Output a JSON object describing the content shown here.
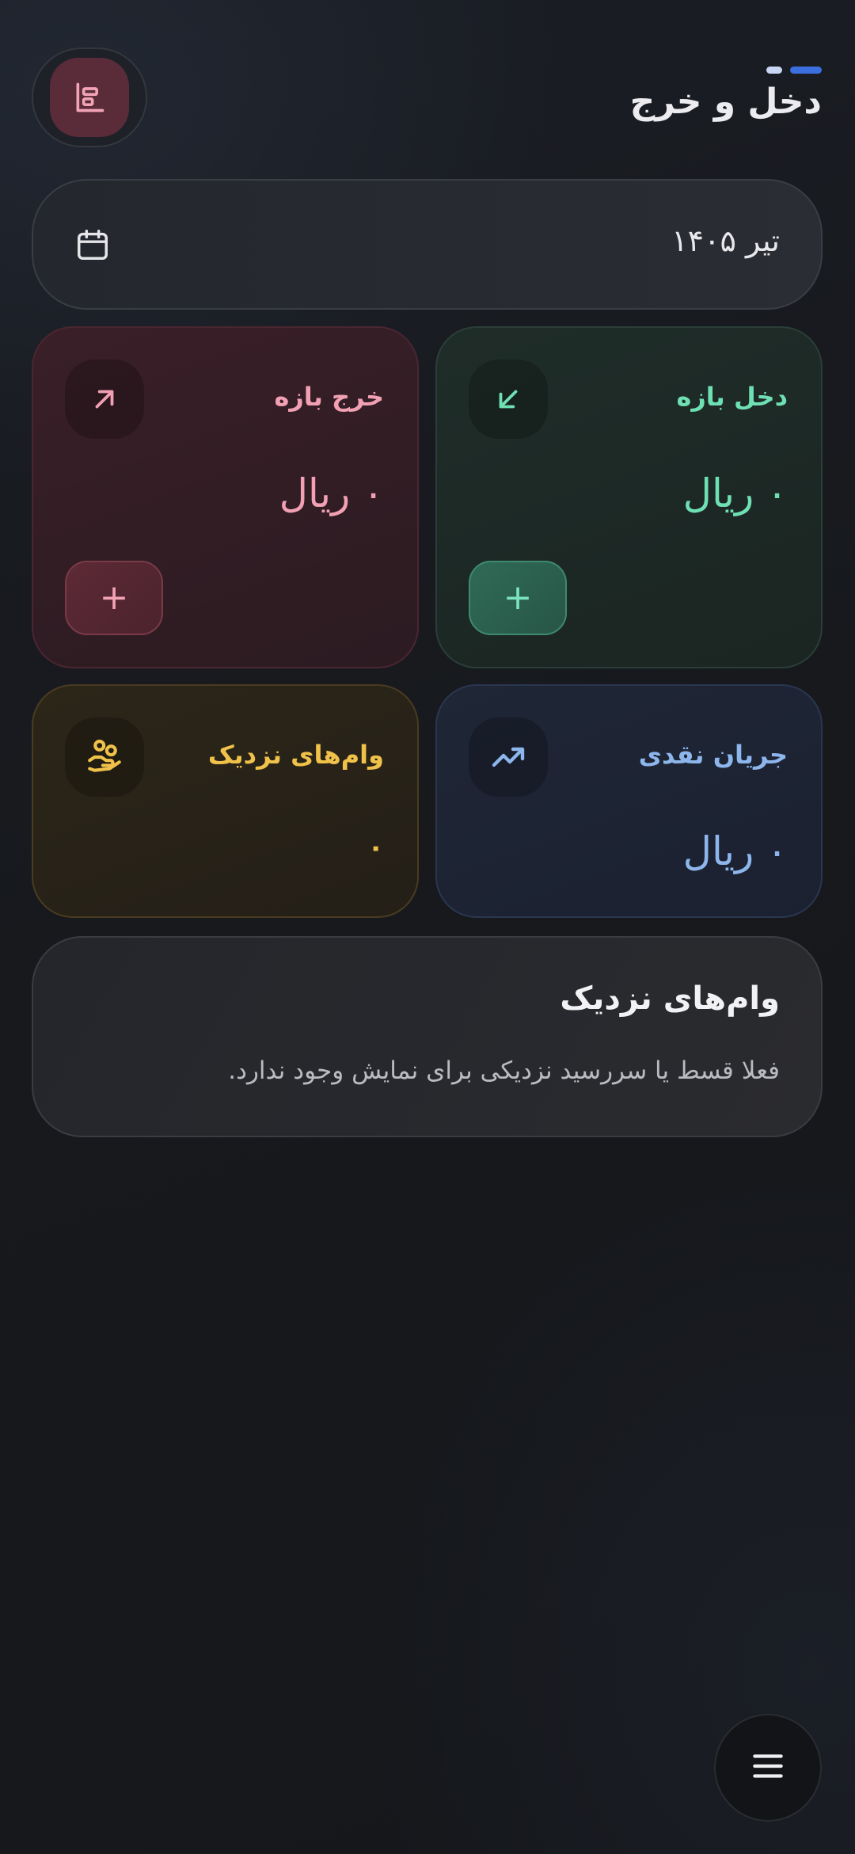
{
  "header": {
    "title": "دخل و خرج",
    "report_icon": "report-icon",
    "accent": "#3b6fe0"
  },
  "date_bar": {
    "label": "تیر ۱۴۰۵",
    "icon": "calendar-icon"
  },
  "cards": {
    "income": {
      "label": "دخل بازه",
      "amount": "۰ ریال",
      "icon": "arrow-down-left-icon",
      "add_label": "+",
      "color": "#6ee0b4"
    },
    "expense": {
      "label": "خرج بازه",
      "amount": "۰ ریال",
      "icon": "arrow-up-right-icon",
      "add_label": "+",
      "color": "#f2a0b3"
    },
    "cashflow": {
      "label": "جریان نقدی",
      "amount": "۰ ریال",
      "icon": "trending-up-icon",
      "color": "#8db6ec"
    },
    "loans": {
      "label": "وام‌های نزدیک",
      "amount": "۰",
      "icon": "hand-coins-icon",
      "color": "#f0c24a"
    }
  },
  "loans_panel": {
    "title": "وام‌های نزدیک",
    "empty_text": "فعلا قسط یا سررسید نزدیکی برای نمایش وجود ندارد."
  },
  "menu": {
    "icon": "menu-icon"
  }
}
